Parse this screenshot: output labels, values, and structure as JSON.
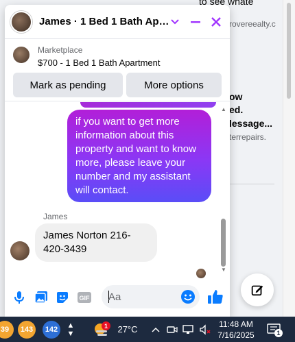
{
  "background": {
    "line1": "to see whate",
    "line2": "rovereealty.c",
    "line3": "ow",
    "line4": "ed.",
    "line5": "lessage...",
    "line6": "terrepairs."
  },
  "chat": {
    "title": "James · 1 Bed 1 Bath Apart…",
    "listing": {
      "label": "Marketplace",
      "title": "$700 - 1 Bed 1 Bath Apartment"
    },
    "buttons": {
      "mark_pending": "Mark as pending",
      "more_options": "More options"
    },
    "messages": {
      "outgoing": "if you want to get more information about this property and want to know more, please leave your number and my assistant will contact.",
      "sender_name": "James",
      "incoming": "James Norton 216-420-3439"
    },
    "composer": {
      "placeholder": "Aa"
    }
  },
  "taskbar": {
    "badges": [
      "39",
      "143",
      "142"
    ],
    "weather_alert": "1",
    "temperature": "27°C",
    "time": "11:48 AM",
    "date": "7/16/2025",
    "notifications": "1"
  },
  "colors": {
    "accent": "#a033ff",
    "messenger_blue": "#0a7cff",
    "taskbar": "#1d2a3f"
  }
}
